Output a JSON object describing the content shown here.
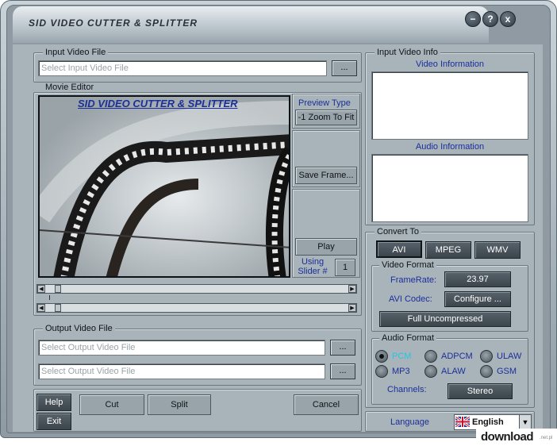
{
  "window": {
    "title": "SID  VIDEO CUTTER & SPLITTER",
    "minimize_glyph": "−",
    "help_glyph": "?",
    "close_glyph": "x"
  },
  "input_file": {
    "group_label": "Input Video File",
    "placeholder": "Select Input Video File",
    "browse_label": "..."
  },
  "movie_editor": {
    "group_label": "Movie Editor",
    "banner": "SID VIDEO CUTTER & SPLITTER",
    "preview_type_label": "Preview Type",
    "zoom_button": "-1 Zoom To Fit",
    "save_frame_button": "Save Frame...",
    "play_button": "Play",
    "using_slider_label": "Using\nSlider #",
    "slider_number": "1",
    "slider1_position": 0.03,
    "slider2_position": 0.03
  },
  "output_file": {
    "group_label": "Output Video File",
    "placeholder1": "Select Output Video File",
    "placeholder2": "Select Output Video File",
    "browse_label": "..."
  },
  "actions": {
    "help": "Help",
    "exit": "Exit",
    "cut": "Cut",
    "split": "Split",
    "cancel": "Cancel"
  },
  "input_info": {
    "group_label": "Input Video Info",
    "video_info_label": "Video Information",
    "audio_info_label": "Audio Information"
  },
  "convert_to": {
    "group_label": "Convert To",
    "formats": [
      "AVI",
      "MPEG",
      "WMV"
    ],
    "selected": "AVI"
  },
  "video_format": {
    "group_label": "Video Format",
    "framerate_label": "FrameRate:",
    "framerate_value": "23.97",
    "codec_label": "AVI Codec:",
    "codec_button": "Configure ...",
    "codec_value": "Full Uncompressed"
  },
  "audio_format": {
    "group_label": "Audio Format",
    "options": [
      "PCM",
      "ADPCM",
      "ULAW",
      "MP3",
      "ALAW",
      "GSM"
    ],
    "selected": "PCM",
    "channels_label": "Channels:",
    "channels_value": "Stereo"
  },
  "language": {
    "label": "Language",
    "value": "English"
  },
  "watermark": {
    "text": "download",
    "suffix": ".net.pl"
  },
  "colors": {
    "panel": "#a9b3ba",
    "label_blue": "#1b2f9a",
    "dark_button": "#454e55",
    "selected_radio_text": "#1ec8e6"
  }
}
